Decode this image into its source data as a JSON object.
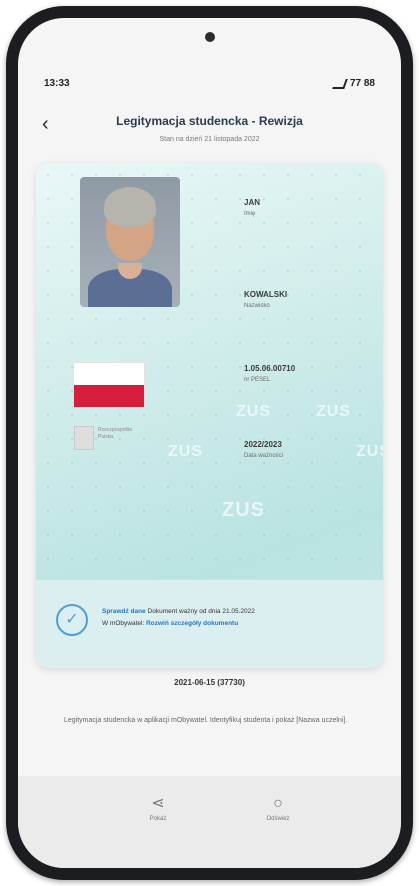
{
  "status_bar": {
    "time": "13:33",
    "battery": "77 88"
  },
  "header": {
    "back_icon": "chevron-left-icon",
    "title": "Legitymacja studencka - Rewizja",
    "subtitle": "Stan na dzień 21 listopada 2022"
  },
  "card": {
    "first_name_value": "JAN",
    "first_name_label": "Imię",
    "last_name_value": "KOWALSKI",
    "last_name_label": "Nazwisko",
    "id_number_value": "1.05.06.00710",
    "id_number_label": "nr PESEL",
    "extra_value": "2022/2023",
    "extra_label": "Data ważności",
    "emblem_text": "Rzeczpospolita Polska",
    "holo_1": "ZUS",
    "holo_2": "ZUS",
    "holo_3": "ZUS",
    "holo_4": "ZUS",
    "holo_5": "ZUS"
  },
  "verify": {
    "text_1": "Dokument ważny od dnia 21.05.2022",
    "link_1": "Sprawdź dane",
    "text_2": "W mObywatel:",
    "link_2": "Rozwiń szczegóły dokumentu"
  },
  "code": "2021-06-15 (37730)",
  "description": "Legitymacja studencka w aplikacji mObywatel. Identyfikuj studenta i pokaż [Nazwa uczelni].",
  "bottom_nav": [
    {
      "icon": "share-icon",
      "label": "Pokaż"
    },
    {
      "icon": "refresh-icon",
      "label": "Odśwież"
    }
  ]
}
